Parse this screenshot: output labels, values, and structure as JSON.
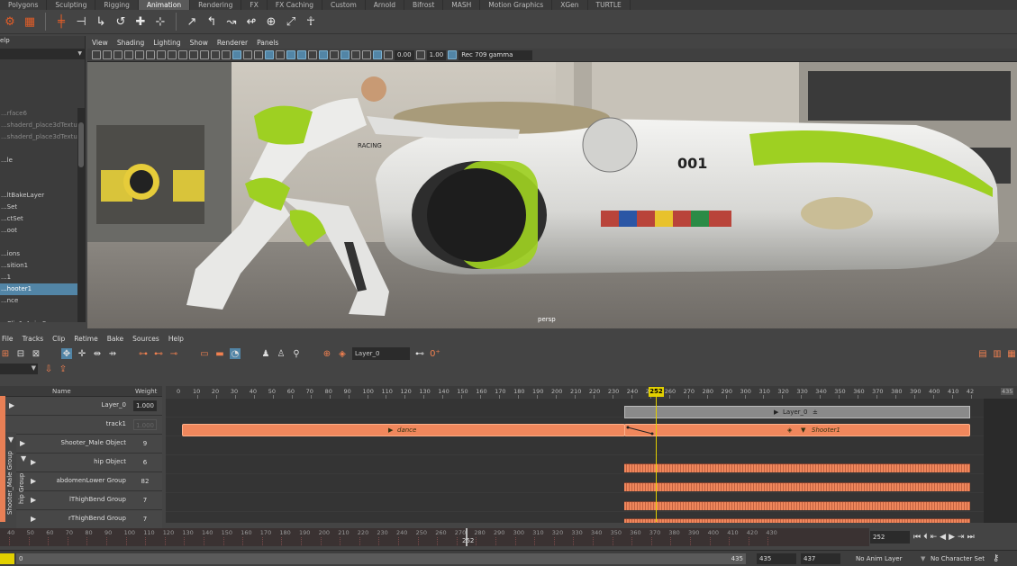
{
  "shelf_tabs": [
    "Polygons",
    "Sculpting",
    "Rigging",
    "Animation",
    "Rendering",
    "FX",
    "FX Caching",
    "Custom",
    "Arnold",
    "Bifrost",
    "MASH",
    "Motion Graphics",
    "XGen",
    "TURTLE"
  ],
  "active_shelf": "Animation",
  "outliner": {
    "header": "elp",
    "rows": [
      {
        "label": "...rface6",
        "dim": true
      },
      {
        "label": "...shaderd_place3dTexture5",
        "dim": true
      },
      {
        "label": "...shaderd_place3dTexture6",
        "dim": true
      },
      {
        "label": "",
        "dim": false
      },
      {
        "label": "...le",
        "dim": false
      },
      {
        "label": "",
        "dim": false
      },
      {
        "label": "",
        "dim": false
      },
      {
        "label": "...ltBakeLayer",
        "dim": false
      },
      {
        "label": "...Set",
        "dim": false
      },
      {
        "label": "...ctSet",
        "dim": false
      },
      {
        "label": "...oot",
        "dim": false
      },
      {
        "label": "",
        "dim": false
      },
      {
        "label": "...ions",
        "dim": false
      },
      {
        "label": "...sition1",
        "dim": false
      },
      {
        "label": "...1",
        "dim": false
      },
      {
        "label": "...hooter1",
        "dim": false,
        "selected": true
      },
      {
        "label": "...nce",
        "dim": false
      },
      {
        "label": "",
        "dim": false
      },
      {
        "label": "...Clip1_AnimSource",
        "dim": false
      }
    ]
  },
  "viewport": {
    "menu": [
      "View",
      "Shading",
      "Lighting",
      "Show",
      "Renderer",
      "Panels"
    ],
    "toolbar": {
      "field1": "0.00",
      "field2": "1.00",
      "color_space": "Rec 709 gamma"
    },
    "camera_label": "persp",
    "scene": {
      "ship_number": "001",
      "racing_text": "RACING"
    }
  },
  "time_editor": {
    "menu": [
      "File",
      "Tracks",
      "Clip",
      "Retime",
      "Bake",
      "Sources",
      "Help"
    ],
    "layer_field": "Layer_0",
    "columns": {
      "name": "Name",
      "weight": "Weight"
    },
    "rows": [
      {
        "name": "Layer_0",
        "weight": "1.000",
        "weight_style": "box",
        "arrow": "▶"
      },
      {
        "name": "track1",
        "weight": "1.000",
        "weight_style": "dim",
        "arrow": ""
      },
      {
        "name": "Shooter_Male Object",
        "weight": "9",
        "weight_style": "none",
        "arrow": "▶"
      },
      {
        "name": "hip Object",
        "weight": "6",
        "weight_style": "none",
        "arrow": "▶"
      },
      {
        "name": "abdomenLower Group",
        "weight": "82",
        "weight_style": "none",
        "arrow": "▶"
      },
      {
        "name": "lThighBend Group",
        "weight": "7",
        "weight_style": "none",
        "arrow": "▶"
      },
      {
        "name": "rThighBend Group",
        "weight": "7",
        "weight_style": "none",
        "arrow": "▶"
      }
    ],
    "group_labels": [
      "Shooter_Male Group",
      "hip Group"
    ],
    "ruler_start": "0",
    "ruler_labels": [
      "10",
      "20",
      "30",
      "40",
      "50",
      "60",
      "70",
      "80",
      "90",
      "100",
      "110",
      "120",
      "130",
      "140",
      "150",
      "160",
      "170",
      "180",
      "190",
      "200",
      "210",
      "220",
      "230",
      "240",
      "250",
      "260",
      "270",
      "280",
      "290",
      "300",
      "310",
      "320",
      "330",
      "340",
      "350",
      "360",
      "370",
      "380",
      "390",
      "400",
      "410",
      "42"
    ],
    "ruler_end": "435",
    "current_frame": "252",
    "clips": {
      "layer": "Layer_0",
      "dance": "dance",
      "shooter": "Shooter1"
    }
  },
  "time_slider": {
    "labels": [
      "40",
      "50",
      "60",
      "70",
      "80",
      "90",
      "100",
      "110",
      "120",
      "130",
      "140",
      "150",
      "160",
      "170",
      "180",
      "190",
      "200",
      "210",
      "220",
      "230",
      "240",
      "250",
      "260",
      "270",
      "280",
      "290",
      "300",
      "310",
      "320",
      "330",
      "340",
      "350",
      "360",
      "370",
      "380",
      "390",
      "400",
      "410",
      "420",
      "430"
    ],
    "current": "252",
    "current_field": "252"
  },
  "range_slider": {
    "start": "0",
    "range_end_label": "435",
    "end": "435",
    "end2": "437",
    "anim_layer": "No Anim Layer",
    "character_set": "No Character Set"
  }
}
